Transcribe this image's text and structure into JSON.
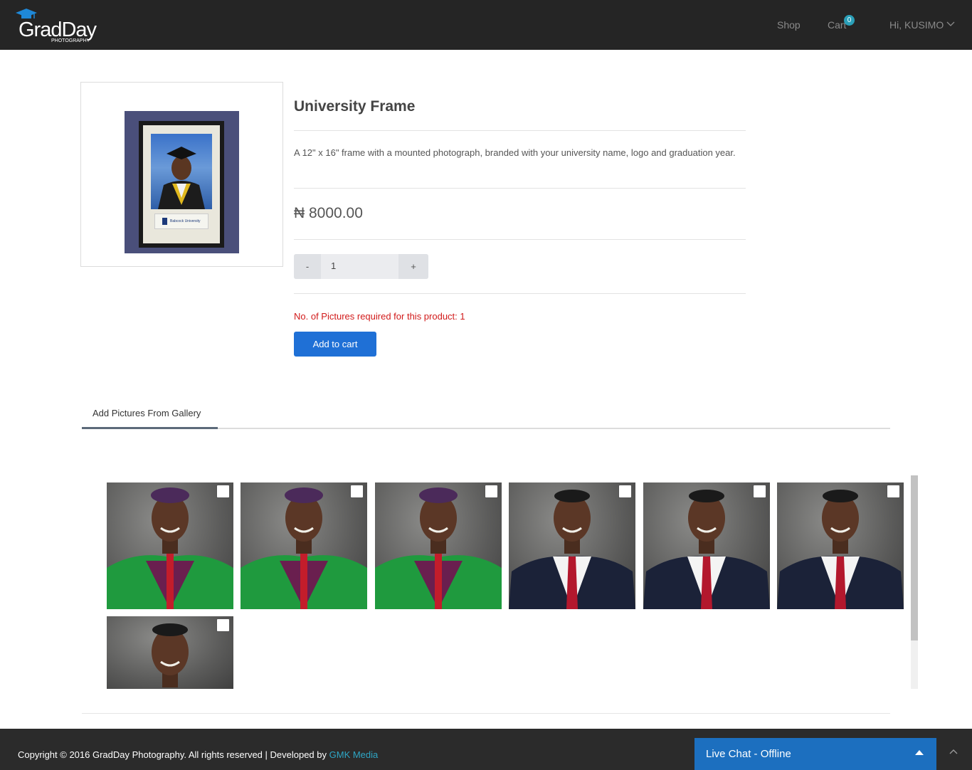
{
  "brand": {
    "name": "GradDay",
    "sub": "PHOTOGRAPHY"
  },
  "nav": {
    "shop": "Shop",
    "cart": "Cart",
    "cart_count": "0",
    "user": "Hi, KUSIMO"
  },
  "product": {
    "title": "University Frame",
    "description": "A 12\" x 16\" frame with a mounted photograph, branded with your university name, logo and graduation year.",
    "price": "₦ 8000.00",
    "quantity": "1",
    "minus": "-",
    "plus": "+",
    "pictures_required": "No. of Pictures required for this product: 1",
    "add_to_cart": "Add to cart",
    "plaque_text": "Babcock University"
  },
  "tabs": [
    {
      "label": "Add Pictures From Gallery"
    }
  ],
  "gallery": {
    "items": [
      {
        "outfit": "green-gown"
      },
      {
        "outfit": "green-gown"
      },
      {
        "outfit": "green-gown"
      },
      {
        "outfit": "navy-suit"
      },
      {
        "outfit": "navy-suit"
      },
      {
        "outfit": "navy-suit"
      },
      {
        "outfit": "navy-suit"
      }
    ]
  },
  "footer": {
    "copyright": "Copyright © 2016 GradDay Photography. All rights reserved | Developed by ",
    "developer": "GMK Media"
  },
  "chat": {
    "label": "Live Chat - Offline"
  },
  "colors": {
    "header_bg": "#252525",
    "accent_blue": "#1f70d6",
    "badge": "#2a9fb8",
    "required_red": "#d11a1a",
    "chat_blue": "#1c6fbf"
  }
}
